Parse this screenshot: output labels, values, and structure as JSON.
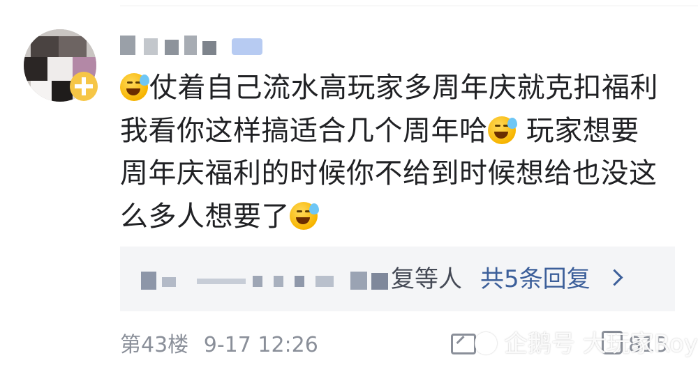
{
  "comment": {
    "lines": [
      "仗着自己流水高玩家多周年庆就克扣福利",
      "我看你这样搞适合几个周年哈",
      " 玩家想要",
      "周年庆福利的时候你不给到时候想给也没这",
      "么多人想要了"
    ],
    "emoji": "laughing-crying-sweat-emoji"
  },
  "replies": {
    "names_suffix": "复等人",
    "count_label": "共5条回复"
  },
  "meta": {
    "floor": "第43楼",
    "time": "9-17 12:26"
  },
  "likes": "815",
  "watermark": "企鹅号 大玩家Roy",
  "colors": {
    "text": "#202124",
    "link": "#3c5f9a",
    "meta": "#8a8f99",
    "reply_bg": "#f4f5f7"
  }
}
